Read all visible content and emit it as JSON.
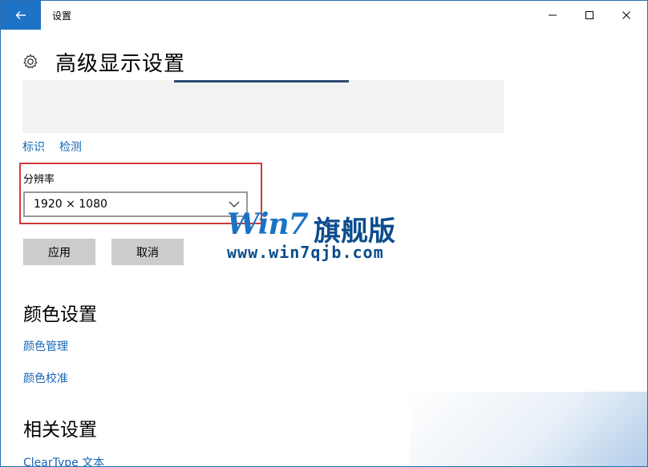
{
  "window": {
    "title": "设置",
    "controls": [
      "minimize-icon",
      "maximize-icon",
      "close-icon"
    ]
  },
  "header": {
    "icon": "gear-icon",
    "title": "高级显示设置"
  },
  "display": {
    "links": [
      "标识",
      "检测"
    ],
    "resolution_label": "分辨率",
    "resolution_value": "1920 × 1080",
    "apply_label": "应用",
    "cancel_label": "取消"
  },
  "color_settings": {
    "title": "颜色设置",
    "links": [
      "颜色管理",
      "颜色校准"
    ]
  },
  "related_settings": {
    "title": "相关设置",
    "links": [
      "ClearType 文本"
    ]
  },
  "watermark": {
    "brand": "Win7",
    "brand_cn": "旗舰版",
    "url": "www.win7qjb.com"
  },
  "colors": {
    "accent": "#1e73c6",
    "link": "#1566b5",
    "highlight_frame": "#cf3b3b"
  }
}
